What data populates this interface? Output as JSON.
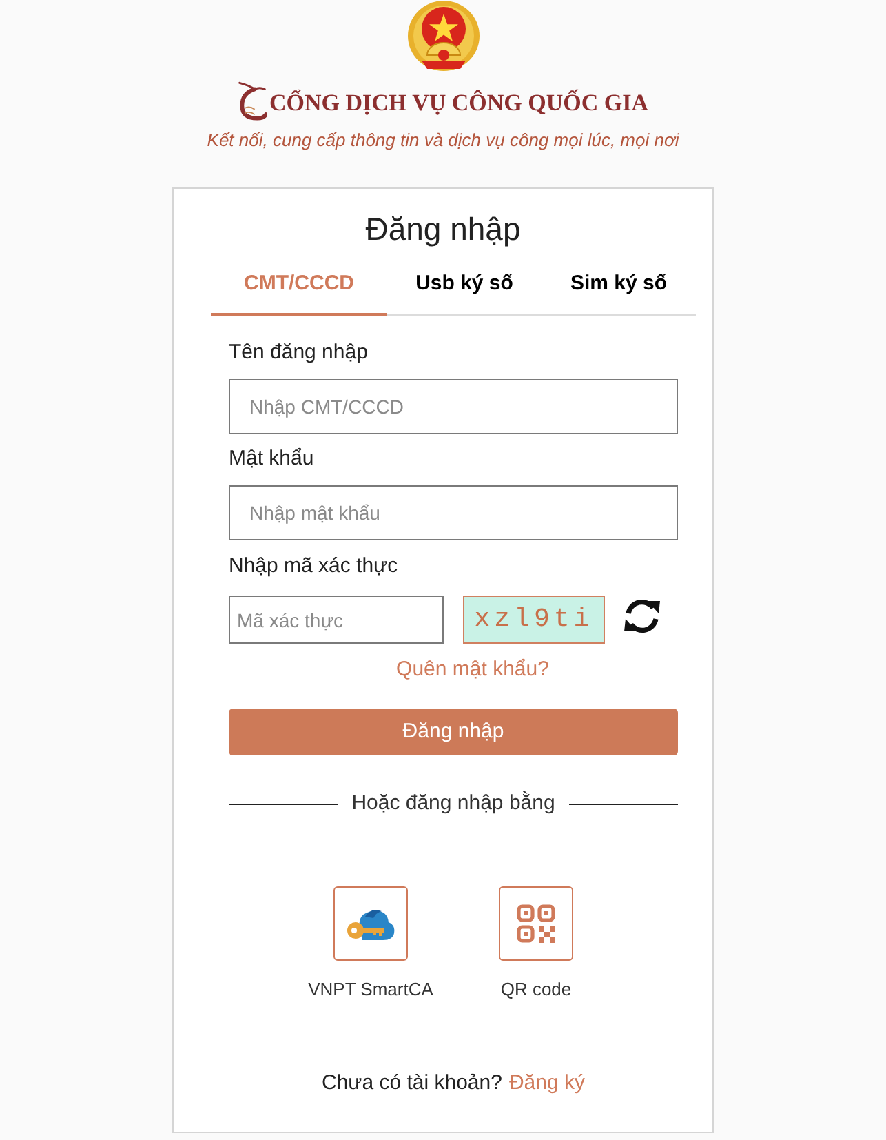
{
  "header": {
    "title": "CỔNG DỊCH VỤ CÔNG QUỐC GIA",
    "tagline": "Kết nối, cung cấp thông tin và dịch vụ công mọi lúc, mọi nơi"
  },
  "login": {
    "title": "Đăng nhập",
    "tabs": [
      {
        "label": "CMT/CCCD",
        "selected": true
      },
      {
        "label": "Usb ký số",
        "selected": false
      },
      {
        "label": "Sim ký số",
        "selected": false
      }
    ],
    "fields": [
      {
        "label": "Tên đăng nhập",
        "placeholder": "Nhập CMT/CCCD"
      },
      {
        "label": "Mật khẩu",
        "placeholder": "Nhập mật khẩu"
      }
    ],
    "captcha": {
      "label": "Nhập mã xác thực",
      "placeholder": "Mã xác thực",
      "code": "xzl9ti"
    },
    "forgot_link": "Quên mật khẩu?",
    "submit_button": "Đăng nhập",
    "divider": "Hoặc đăng nhập bằng",
    "alt_methods": [
      {
        "label": "VNPT SmartCA",
        "kind": "smartca"
      },
      {
        "label": "QR code",
        "kind": "qr"
      }
    ],
    "signup": {
      "prompt": "Chưa có tài khoản?",
      "link": "Đăng ký"
    }
  }
}
